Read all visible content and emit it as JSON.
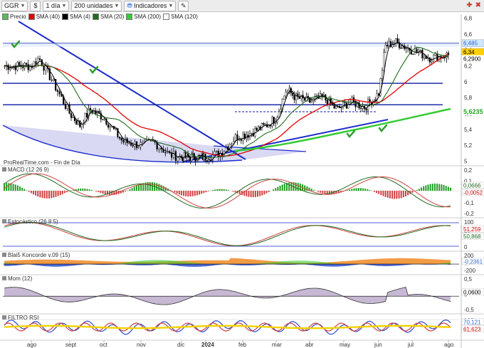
{
  "toolbar": {
    "symbol": "GGR",
    "timeframe": "1 día",
    "units": "200 unidades",
    "indicators_label": "Indicadores",
    "dollar_icon": "dollar-icon",
    "pencil_icon": "pencil-icon",
    "close_icon": "close-icon",
    "add_icon": "add-icon"
  },
  "legend": [
    {
      "label": "Precio",
      "color": "#5cb85c"
    },
    {
      "label": "SMA (40)",
      "color": "#e00000"
    },
    {
      "label": "SMA (4)",
      "color": "#000000"
    },
    {
      "label": "SMA (20)",
      "color": "#1f6b1f"
    },
    {
      "label": "SMA (200)",
      "color": "#33cc33"
    },
    {
      "label": "SMA (120)",
      "color": "#ffffff"
    }
  ],
  "watermark": "ProRealTime.com - Fin de Día",
  "price_axis": {
    "ticks": [
      "6,8",
      "6,6",
      "6,4",
      "6,2",
      "6",
      "5,8",
      "5,6",
      "5,4",
      "5,2",
      "5"
    ],
    "labels": [
      {
        "text": "6,485",
        "bg": "#cfe6ff",
        "fg": "#3366cc"
      },
      {
        "text": "6,34",
        "bg": "#ffd000",
        "fg": "#000000"
      },
      {
        "text": "6,2900",
        "bg": "#ffffff",
        "fg": "#000000"
      },
      {
        "text": "5,6235",
        "bg": "#ffffff",
        "fg": "#22aa22"
      }
    ]
  },
  "panels": [
    {
      "name": "macd",
      "title": "MACD (12 26 9)",
      "ticks": [
        "0,2",
        "0,1",
        "0",
        "-0,1",
        "-0,2"
      ],
      "labels": [
        {
          "text": "0,0666",
          "fg": "#1f6b1f"
        },
        {
          "text": "-0,0052",
          "fg": "#cc0000"
        }
      ]
    },
    {
      "name": "stochastic",
      "title": "Estocástico (26 8 5)",
      "ticks": [
        "100",
        "50",
        "0"
      ],
      "labels": [
        {
          "text": "51,259",
          "fg": "#cc0000"
        },
        {
          "text": "50,868",
          "fg": "#1f6b1f"
        }
      ]
    },
    {
      "name": "koncorde",
      "title": "Blai5 Koncorde v.09 (15)",
      "ticks": [
        "200",
        "0",
        "-200"
      ],
      "labels": [
        {
          "text": "-0,2361",
          "fg": "#3366cc"
        }
      ]
    },
    {
      "name": "momentum",
      "title": "Mom (12)",
      "ticks": [
        "0,5",
        "0",
        "-0,5"
      ],
      "labels": [
        {
          "text": "0,0600",
          "fg": "#000000"
        }
      ]
    },
    {
      "name": "filtro-rsi",
      "title": "FILTRO RSI",
      "ticks": [
        "100"
      ],
      "labels": [
        {
          "text": "70,121",
          "fg": "#3366cc"
        },
        {
          "text": "61,623",
          "fg": "#cc0000"
        }
      ]
    }
  ],
  "x_axis": [
    "ago",
    "sept",
    "oct",
    "nov",
    "dic",
    "2024",
    "feb",
    "mar",
    "abr",
    "may",
    "jun",
    "jul",
    "ago"
  ],
  "chart_data": {
    "type": "candlestick",
    "title": "GGR",
    "interval": "1 día",
    "x": [
      "ago",
      "sept",
      "oct",
      "nov",
      "dic",
      "2024",
      "feb",
      "mar",
      "abr",
      "may",
      "jun",
      "jul",
      "ago"
    ],
    "close_approx": [
      6.25,
      5.45,
      5.55,
      5.15,
      5.05,
      5.05,
      5.3,
      5.5,
      5.75,
      5.75,
      6.35,
      6.3,
      6.34
    ],
    "levels": [
      6.485,
      5.98,
      5.71
    ],
    "last_close": 6.34,
    "sma200_last": 5.6235,
    "ylim": [
      4.95,
      6.85
    ]
  }
}
